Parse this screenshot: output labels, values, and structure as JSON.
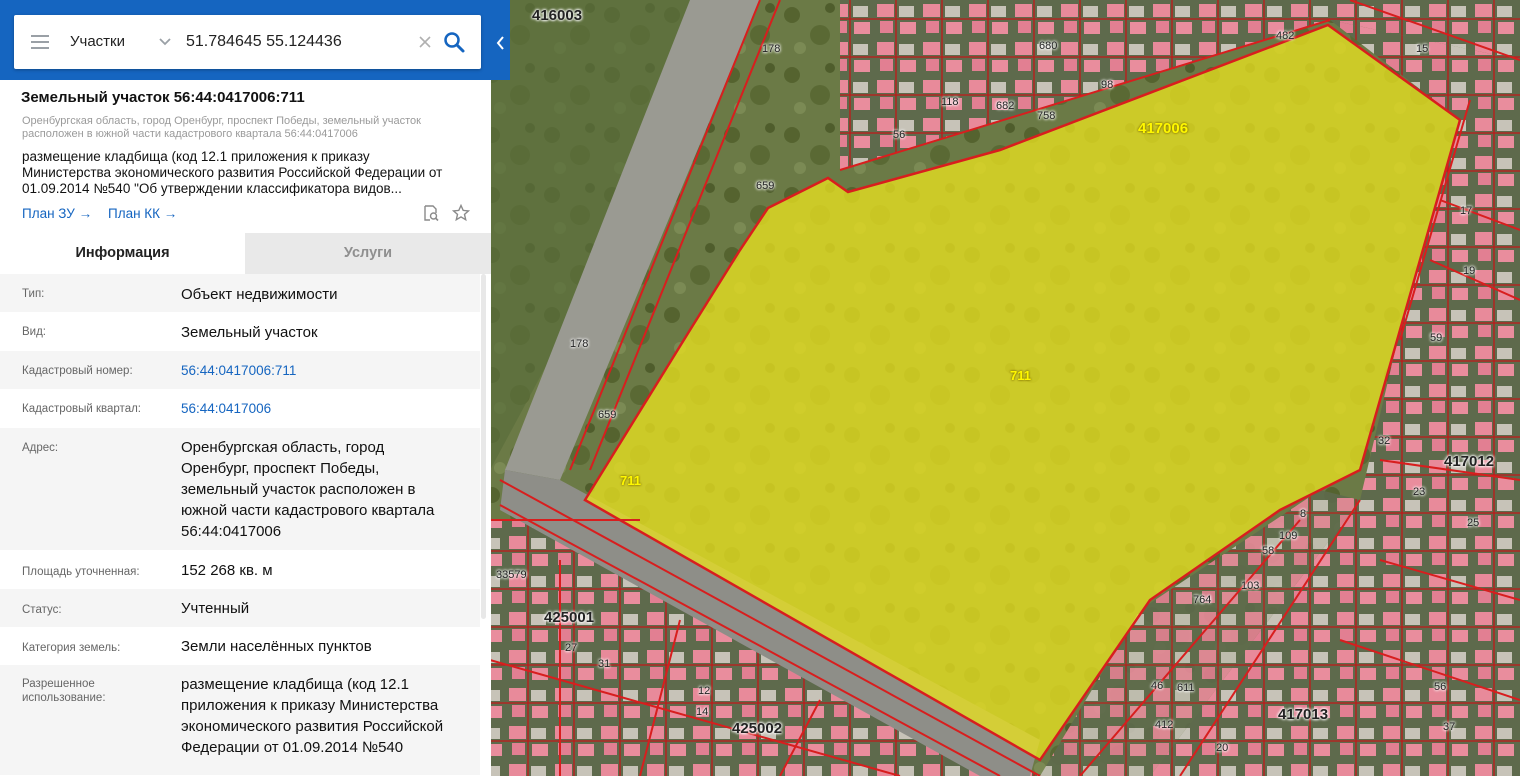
{
  "search": {
    "layer": "Участки",
    "query": "51.784645 55.124436"
  },
  "parcel": {
    "title": "Земельный участок 56:44:0417006:711",
    "location": "Оренбургская область, город Оренбург, проспект Победы, земельный участок расположен в южной части кадастрового квартала 56:44:0417006",
    "use_line1": "размещение кладбища (код 12.1 приложения к приказу",
    "use_line2": "Министерства экономического развития Российской Федерации от",
    "use_line3": "01.09.2014 №540 \"Об утверждении классификатора видов...",
    "plan_zu": "План ЗУ →",
    "plan_kk": "План КК →"
  },
  "tabs": {
    "info": "Информация",
    "services": "Услуги"
  },
  "info": {
    "type_label": "Тип:",
    "type_value": "Объект недвижимости",
    "kind_label": "Вид:",
    "kind_value": "Земельный участок",
    "cad_number_label": "Кадастровый номер:",
    "cad_number_value": "56:44:0417006:711",
    "cad_block_label": "Кадастровый квартал:",
    "cad_block_value": "56:44:0417006",
    "address_label": "Адрес:",
    "address_line1": "Оренбургская область, город",
    "address_line2": "Оренбург, проспект Победы,",
    "address_line3": "земельный участок расположен в",
    "address_line4": "южной части кадастрового квартала",
    "address_line5": "56:44:0417006",
    "area_label": "Площадь уточненная:",
    "area_value": "152 268 кв. м",
    "status_label": "Статус:",
    "status_value": "Учтенный",
    "category_label": "Категория земель:",
    "category_value": "Земли населённых пунктов",
    "permitted_label_1": "Разрешенное",
    "permitted_label_2": "использование:",
    "permitted_line1": "размещение кладбища (код 12.1",
    "permitted_line2": "приложения к приказу Министерства",
    "permitted_line3": "экономического развития Российской",
    "permitted_line4": "Федерации от 01.09.2014 №540"
  },
  "map_labels": {
    "block_416003": "416003",
    "block_417006": "417006",
    "block_417012": "417012",
    "block_417013": "417013",
    "block_425001": "425001",
    "block_425002": "425002",
    "parcel_711_center": "711",
    "parcel_711_edge": "711",
    "n178a": "178",
    "n178b": "178",
    "n659a": "659",
    "n659b": "659",
    "n56": "56",
    "n118": "118",
    "n682": "682",
    "n680": "680",
    "n98": "98",
    "n15": "15",
    "n482": "482",
    "n33579": "33579",
    "n758": "758",
    "n17": "17",
    "n19": "19",
    "n59": "59",
    "n32": "32",
    "n23": "23",
    "n25": "25",
    "n109": "109",
    "n58": "58",
    "n103": "103",
    "n764": "764",
    "n8": "8",
    "n31": "31",
    "n12": "12",
    "n14": "14",
    "n20": "20",
    "n46": "46",
    "n412": "412",
    "n56b": "56",
    "n37": "37",
    "n611": "611",
    "n27": "27"
  },
  "colors": {
    "header_blue": "#1565c0",
    "parcel_fill": "#e8e020",
    "boundary_red": "#d81e1e"
  }
}
